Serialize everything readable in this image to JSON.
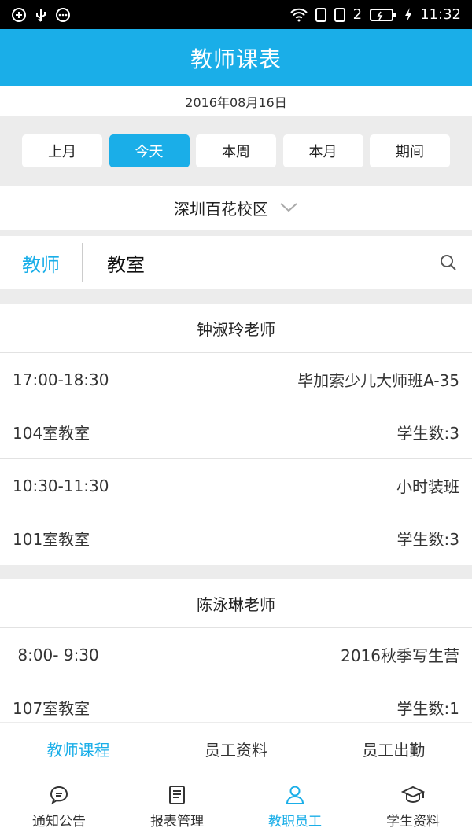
{
  "status": {
    "signal_indicator": "2",
    "time": "11:32"
  },
  "header": {
    "title": "教师课表"
  },
  "date": "2016年08月16日",
  "ranges": [
    {
      "label": "上月",
      "active": false
    },
    {
      "label": "今天",
      "active": true
    },
    {
      "label": "本周",
      "active": false
    },
    {
      "label": "本月",
      "active": false
    },
    {
      "label": "期间",
      "active": false
    }
  ],
  "campus": {
    "label": "深圳百花校区"
  },
  "search": {
    "mode": "教师",
    "value": "教室"
  },
  "groups": [
    {
      "teacher": "钟淑玲老师",
      "lessons": [
        {
          "time": "17:00-18:30",
          "course": "毕加索少儿大师班A-35",
          "room": "104室教室",
          "students": "学生数:3"
        },
        {
          "time": "10:30-11:30",
          "course": "小时装班",
          "room": "101室教室",
          "students": "学生数:3"
        }
      ]
    },
    {
      "teacher": "陈泳琳老师",
      "lessons": [
        {
          "time": " 8:00- 9:30",
          "course": "2016秋季写生营",
          "room": "107室教室",
          "students": "学生数:1"
        }
      ]
    }
  ],
  "subtabs": [
    {
      "label": "教师课程",
      "active": true
    },
    {
      "label": "员工资料",
      "active": false
    },
    {
      "label": "员工出勤",
      "active": false
    }
  ],
  "nav": [
    {
      "label": "通知公告",
      "icon": "chat-bubble-icon",
      "active": false
    },
    {
      "label": "报表管理",
      "icon": "report-icon",
      "active": false
    },
    {
      "label": "教职员工",
      "icon": "person-icon",
      "active": true
    },
    {
      "label": "学生资料",
      "icon": "graduation-cap-icon",
      "active": false
    }
  ],
  "colors": {
    "accent": "#1aaee8",
    "background": "#ececec"
  }
}
